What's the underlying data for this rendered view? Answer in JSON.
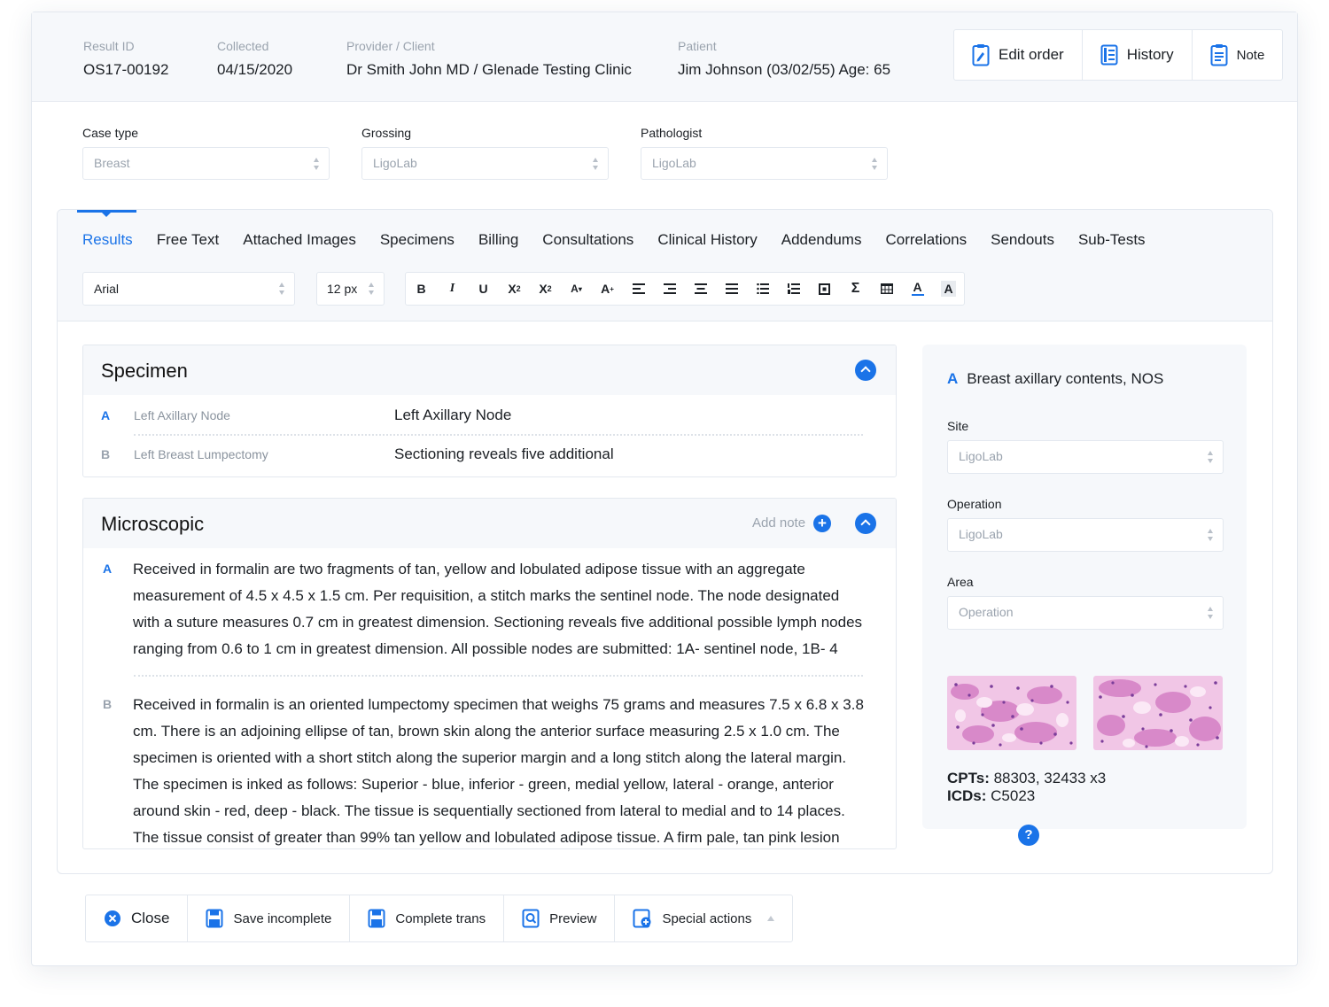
{
  "header": {
    "fields": [
      {
        "label": "Result ID",
        "value": "OS17-00192"
      },
      {
        "label": "Collected",
        "value": "04/15/2020"
      },
      {
        "label": "Provider / Client",
        "value": "Dr Smith John MD / Glenade Testing Clinic"
      },
      {
        "label": "Patient",
        "value": "Jim Johnson (03/02/55) Age: 65"
      }
    ],
    "buttons": {
      "edit_order": "Edit order",
      "history": "History",
      "note": "Note"
    }
  },
  "case_fields": [
    {
      "label": "Case type",
      "value": "Breast"
    },
    {
      "label": "Grossing",
      "value": "LigoLab"
    },
    {
      "label": "Pathologist",
      "value": "LigoLab"
    }
  ],
  "tabs": [
    "Results",
    "Free Text",
    "Attached Images",
    "Specimens",
    "Billing",
    "Consultations",
    "Clinical History",
    "Addendums",
    "Correlations",
    "Sendouts",
    "Sub-Tests"
  ],
  "active_tab": "Results",
  "editor": {
    "font": "Arial",
    "size": "12 px",
    "toolbar": [
      "bold",
      "italic",
      "underline",
      "superscript",
      "subscript",
      "font-size-decrease",
      "font-size-increase",
      "align-left",
      "align-right",
      "align-center",
      "align-justify",
      "bullet-list",
      "numbered-list",
      "insert-field",
      "sum",
      "table",
      "font-color",
      "highlight"
    ]
  },
  "specimen": {
    "title": "Specimen",
    "rows": [
      {
        "letter": "A",
        "name": "Left Axillary Node",
        "description": "Left Axillary Node"
      },
      {
        "letter": "B",
        "name": "Left Breast Lumpectomy",
        "description": "Sectioning reveals five additional"
      }
    ]
  },
  "microscopic": {
    "title": "Microscopic",
    "add_note": "Add note",
    "entries": [
      {
        "letter": "A",
        "text": "Received in formalin are two fragments of tan, yellow and lobulated adipose tissue with an aggregate measurement of 4.5 x 4.5 x 1.5 cm.  Per requisition, a stitch marks the sentinel node. The node designated with a suture measures 0.7 cm in greatest dimension.  Sectioning reveals five additional possible lymph nodes ranging from 0.6 to 1 cm in greatest dimension.  All possible nodes are submitted:  1A- sentinel node, 1B- 4"
      },
      {
        "letter": "B",
        "text": "Received in formalin is an oriented lumpectomy specimen that weighs 75 grams and measures 7.5 x 6.8 x 3.8 cm.  There is an adjoining ellipse of tan, brown skin along the anterior surface measuring 2.5 x 1.0 cm.  The specimen is oriented with a short stitch along the superior margin and a long stitch along the lateral margin.  The specimen is inked as follows:  Superior - blue, inferior - green, medial yellow, lateral - orange, anterior around skin - red, deep - black.  The tissue is sequentially sectioned from lateral to medial and to 14 places.  The tissue consist of greater than 99% tan yellow and lobulated adipose tissue.  A firm pale, tan pink lesion extends from"
      }
    ]
  },
  "side_panel": {
    "letter": "A",
    "title": "Breast axillary contents, NOS",
    "fields": [
      {
        "label": "Site",
        "value": "LigoLab"
      },
      {
        "label": "Operation",
        "value": "LigoLab"
      },
      {
        "label": "Area",
        "value": "Operation"
      }
    ],
    "cpts_label": "CPTs:",
    "cpts_value": " 88303, 32433 x3",
    "icds_label": "ICDs:",
    "icds_value": " C5023"
  },
  "bottom_actions": {
    "close": "Close",
    "save_incomplete": "Save incomplete",
    "complete": "Complete trans",
    "preview": "Preview",
    "special": "Special actions"
  },
  "colors": {
    "accent": "#1a73e8",
    "panel_bg": "#f6f8fb",
    "border": "#e3e8ef"
  }
}
